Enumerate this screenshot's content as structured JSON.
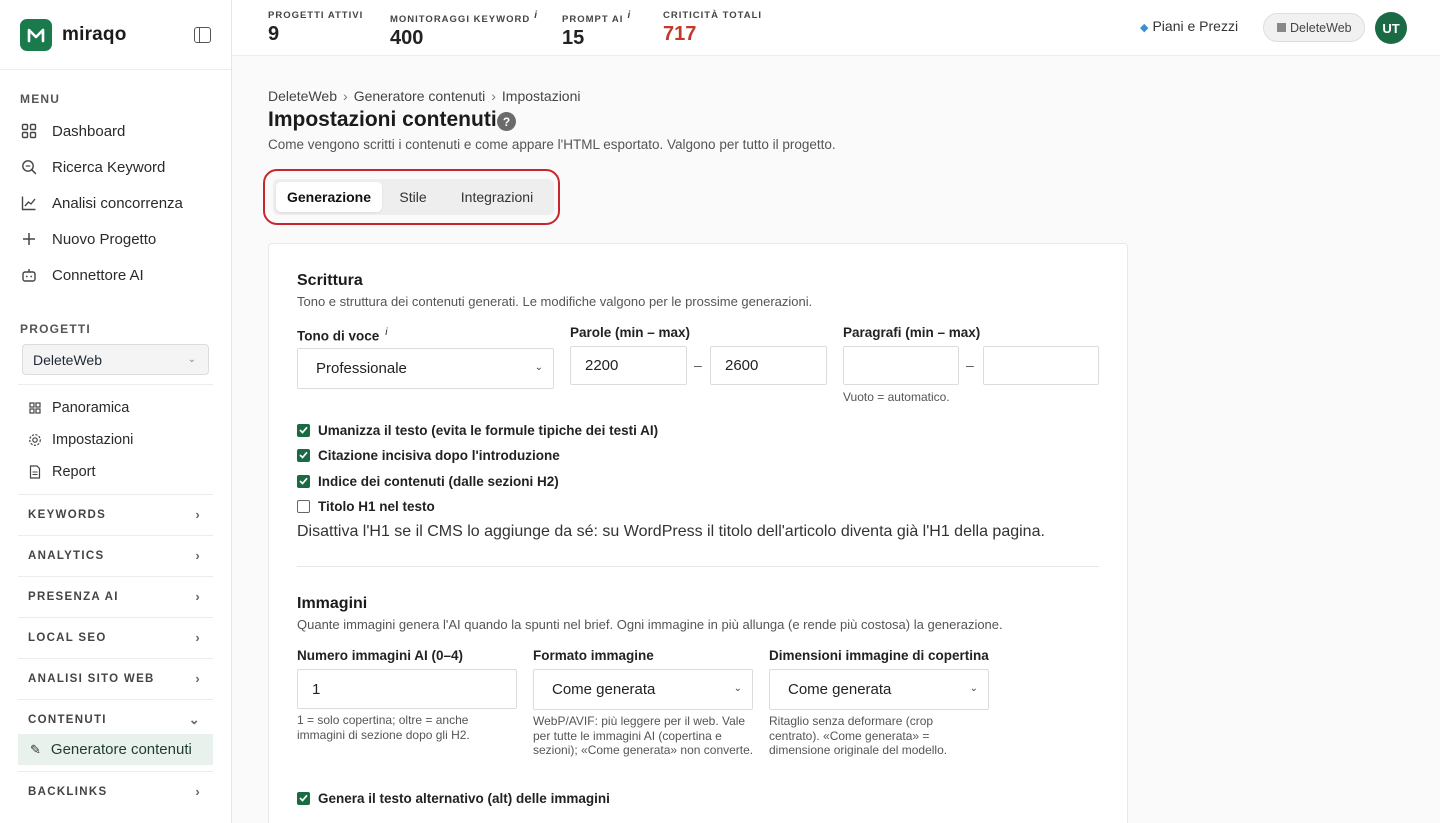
{
  "brand": {
    "name": "miraqo",
    "logo_letter": "M",
    "color": "#1a7a4c"
  },
  "sidebar": {
    "menu_label": "MENU",
    "menu": [
      {
        "label": "Dashboard",
        "icon": "grid-icon"
      },
      {
        "label": "Ricerca Keyword",
        "icon": "search-icon"
      },
      {
        "label": "Analisi concorrenza",
        "icon": "chart-line-icon"
      },
      {
        "label": "Nuovo Progetto",
        "icon": "plus-icon"
      },
      {
        "label": "Connettore AI",
        "icon": "robot-icon"
      }
    ],
    "projects_label": "PROGETTI",
    "project_selected": "DeleteWeb",
    "project_items": [
      {
        "label": "Panoramica",
        "icon": "grid-icon"
      },
      {
        "label": "Impostazioni",
        "icon": "gear-icon"
      },
      {
        "label": "Report",
        "icon": "document-icon"
      }
    ],
    "groups": [
      "KEYWORDS",
      "ANALYTICS",
      "PRESENZA AI",
      "LOCAL SEO",
      "ANALISI SITO WEB",
      "CONTENUTI",
      "BACKLINKS"
    ],
    "active_item": "Generatore contenuti"
  },
  "topbar": {
    "stats": [
      {
        "label": "PROGETTI ATTIVI",
        "value": "9",
        "info": ""
      },
      {
        "label": "MONITORAGGI KEYWORD",
        "value": "400",
        "info": "i"
      },
      {
        "label": "PROMPT AI",
        "value": "15",
        "info": "i"
      },
      {
        "label": "CRITICITÀ TOTALI",
        "value": "717",
        "info": ""
      }
    ],
    "plans_label": "Piani e Prezzi",
    "workspace": "DeleteWeb",
    "avatar_initials": "UT"
  },
  "breadcrumb": [
    "DeleteWeb",
    "Generatore contenuti",
    "Impostazioni"
  ],
  "page": {
    "title": "Impostazioni contenuti",
    "help": "?",
    "subtitle": "Come vengono scritti i contenuti e come appare l'HTML esportato. Valgono per tutto il progetto."
  },
  "tabs": [
    "Generazione",
    "Stile",
    "Integrazioni"
  ],
  "writing": {
    "title": "Scrittura",
    "desc": "Tono e struttura dei contenuti generati. Le modifiche valgono per le prossime generazioni.",
    "tone_label": "Tono di voce",
    "tone_info": "i",
    "tone_value": "Professionale",
    "words_label": "Parole (min – max)",
    "words_min": "2200",
    "words_max": "2600",
    "paragraphs_label": "Paragrafi (min – max)",
    "paragraphs_min": "",
    "paragraphs_max": "",
    "paragraphs_hint": "Vuoto = automatico.",
    "range_sep": "–",
    "checks": [
      {
        "label": "Umanizza il testo (evita le formule tipiche dei testi AI)",
        "checked": true
      },
      {
        "label": "Citazione incisiva dopo l'introduzione",
        "checked": true
      },
      {
        "label": "Indice dei contenuti (dalle sezioni H2)",
        "checked": true
      },
      {
        "label": "Titolo H1 nel testo",
        "checked": false
      }
    ],
    "h1_note": "Disattiva l'H1 se il CMS lo aggiunge da sé: su WordPress il titolo dell'articolo diventa già l'H1 della pagina."
  },
  "images": {
    "title": "Immagini",
    "desc": "Quante immagini genera l'AI quando la spunti nel brief. Ogni immagine in più allunga (e rende più costosa) la generazione.",
    "count_label": "Numero immagini AI (0–4)",
    "count_value": "1",
    "count_hint": "1 = solo copertina; oltre = anche immagini di sezione dopo gli H2.",
    "format_label": "Formato immagine",
    "format_value": "Come generata",
    "format_hint": "WebP/AVIF: più leggere per il web. Vale per tutte le immagini AI (copertina e sezioni); «Come generata» non converte.",
    "cover_label": "Dimensioni immagine di copertina",
    "cover_value": "Come generata",
    "cover_hint": "Ritaglio senza deformare (crop centrato). «Come generata» = dimensione originale del modello.",
    "alt_label": "Genera il testo alternativo (alt) delle immagini",
    "alt_checked": true
  }
}
